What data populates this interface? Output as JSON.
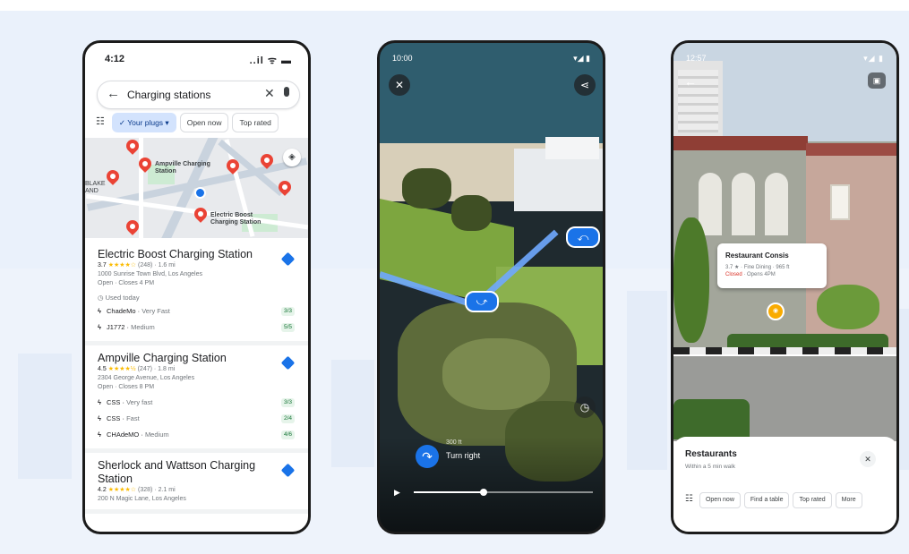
{
  "phone1": {
    "status": {
      "time": "4:12",
      "icons": "..il ᯤ ▬"
    },
    "search": {
      "back_icon": "←",
      "query": "Charging stations",
      "clear_icon": "✕"
    },
    "filters": {
      "filter_icon": "☷",
      "chips": [
        "✓ Your plugs ▾",
        "Open now",
        "Top rated"
      ]
    },
    "map": {
      "labels": [
        "Ampville Charging Station",
        "Electric Boost Charging Station"
      ],
      "edge_label": "BLAKE AND",
      "layers_icon": "◈"
    },
    "stations": [
      {
        "name": "Electric Boost Charging Station",
        "rating": "3.7",
        "stars": "★★★★☆",
        "reviews": "(248) · 1.6 mi",
        "address": "1000 Sunrise Town Blvd, Los Angeles",
        "hours": "Open · Closes 4 PM",
        "note": "Used today",
        "plugs": [
          {
            "name": "ChadeMo",
            "speed": "Very Fast",
            "avail": "3/3"
          },
          {
            "name": "J1772",
            "speed": "Medium",
            "avail": "5/5"
          }
        ]
      },
      {
        "name": "Ampville Charging Station",
        "rating": "4.5",
        "stars": "★★★★½",
        "reviews": "(247) · 1.8 mi",
        "address": "2304 George Avenue, Los Angeles",
        "hours": "Open · Closes 8 PM",
        "note": "",
        "plugs": [
          {
            "name": "CSS",
            "speed": "Very fast",
            "avail": "3/3"
          },
          {
            "name": "CSS",
            "speed": "Fast",
            "avail": "2/4"
          },
          {
            "name": "CHAdeMO",
            "speed": "Medium",
            "avail": "4/6"
          }
        ]
      },
      {
        "name": "Sherlock and Wattson Charging Station",
        "rating": "4.2",
        "stars": "★★★★☆",
        "reviews": "(328) · 2.1 mi",
        "address": "200 N Magic Lane, Los Angeles",
        "hours": "",
        "note": "",
        "plugs": []
      }
    ]
  },
  "phone2": {
    "status": {
      "time": "10:00",
      "icons": "▾◢ ▮"
    },
    "close_icon": "✕",
    "share_icon": "⋖",
    "turn_arrow": "↷",
    "turn_text": "Turn right",
    "turn_distance": "300 ft",
    "play_icon": "▶",
    "history_icon": "◷",
    "progress": 0.39
  },
  "phone3": {
    "status": {
      "time": "12:57",
      "icons": "▾◢ ▮"
    },
    "back_icon": "←",
    "chat_icon": "▣",
    "poi": {
      "name": "Restaurant Consis",
      "rating_line": "3.7 ★ · Fine Dining · 965 ft",
      "closed": "Closed",
      "opens": " · Opens 4PM",
      "marker_icon": "◉"
    },
    "sheet": {
      "title": "Restaurants",
      "subtitle": "Within a 5 min walk",
      "close_icon": "✕",
      "filter_icon": "☷",
      "chips": [
        "Open now",
        "Find a table",
        "Top rated",
        "More"
      ]
    }
  }
}
